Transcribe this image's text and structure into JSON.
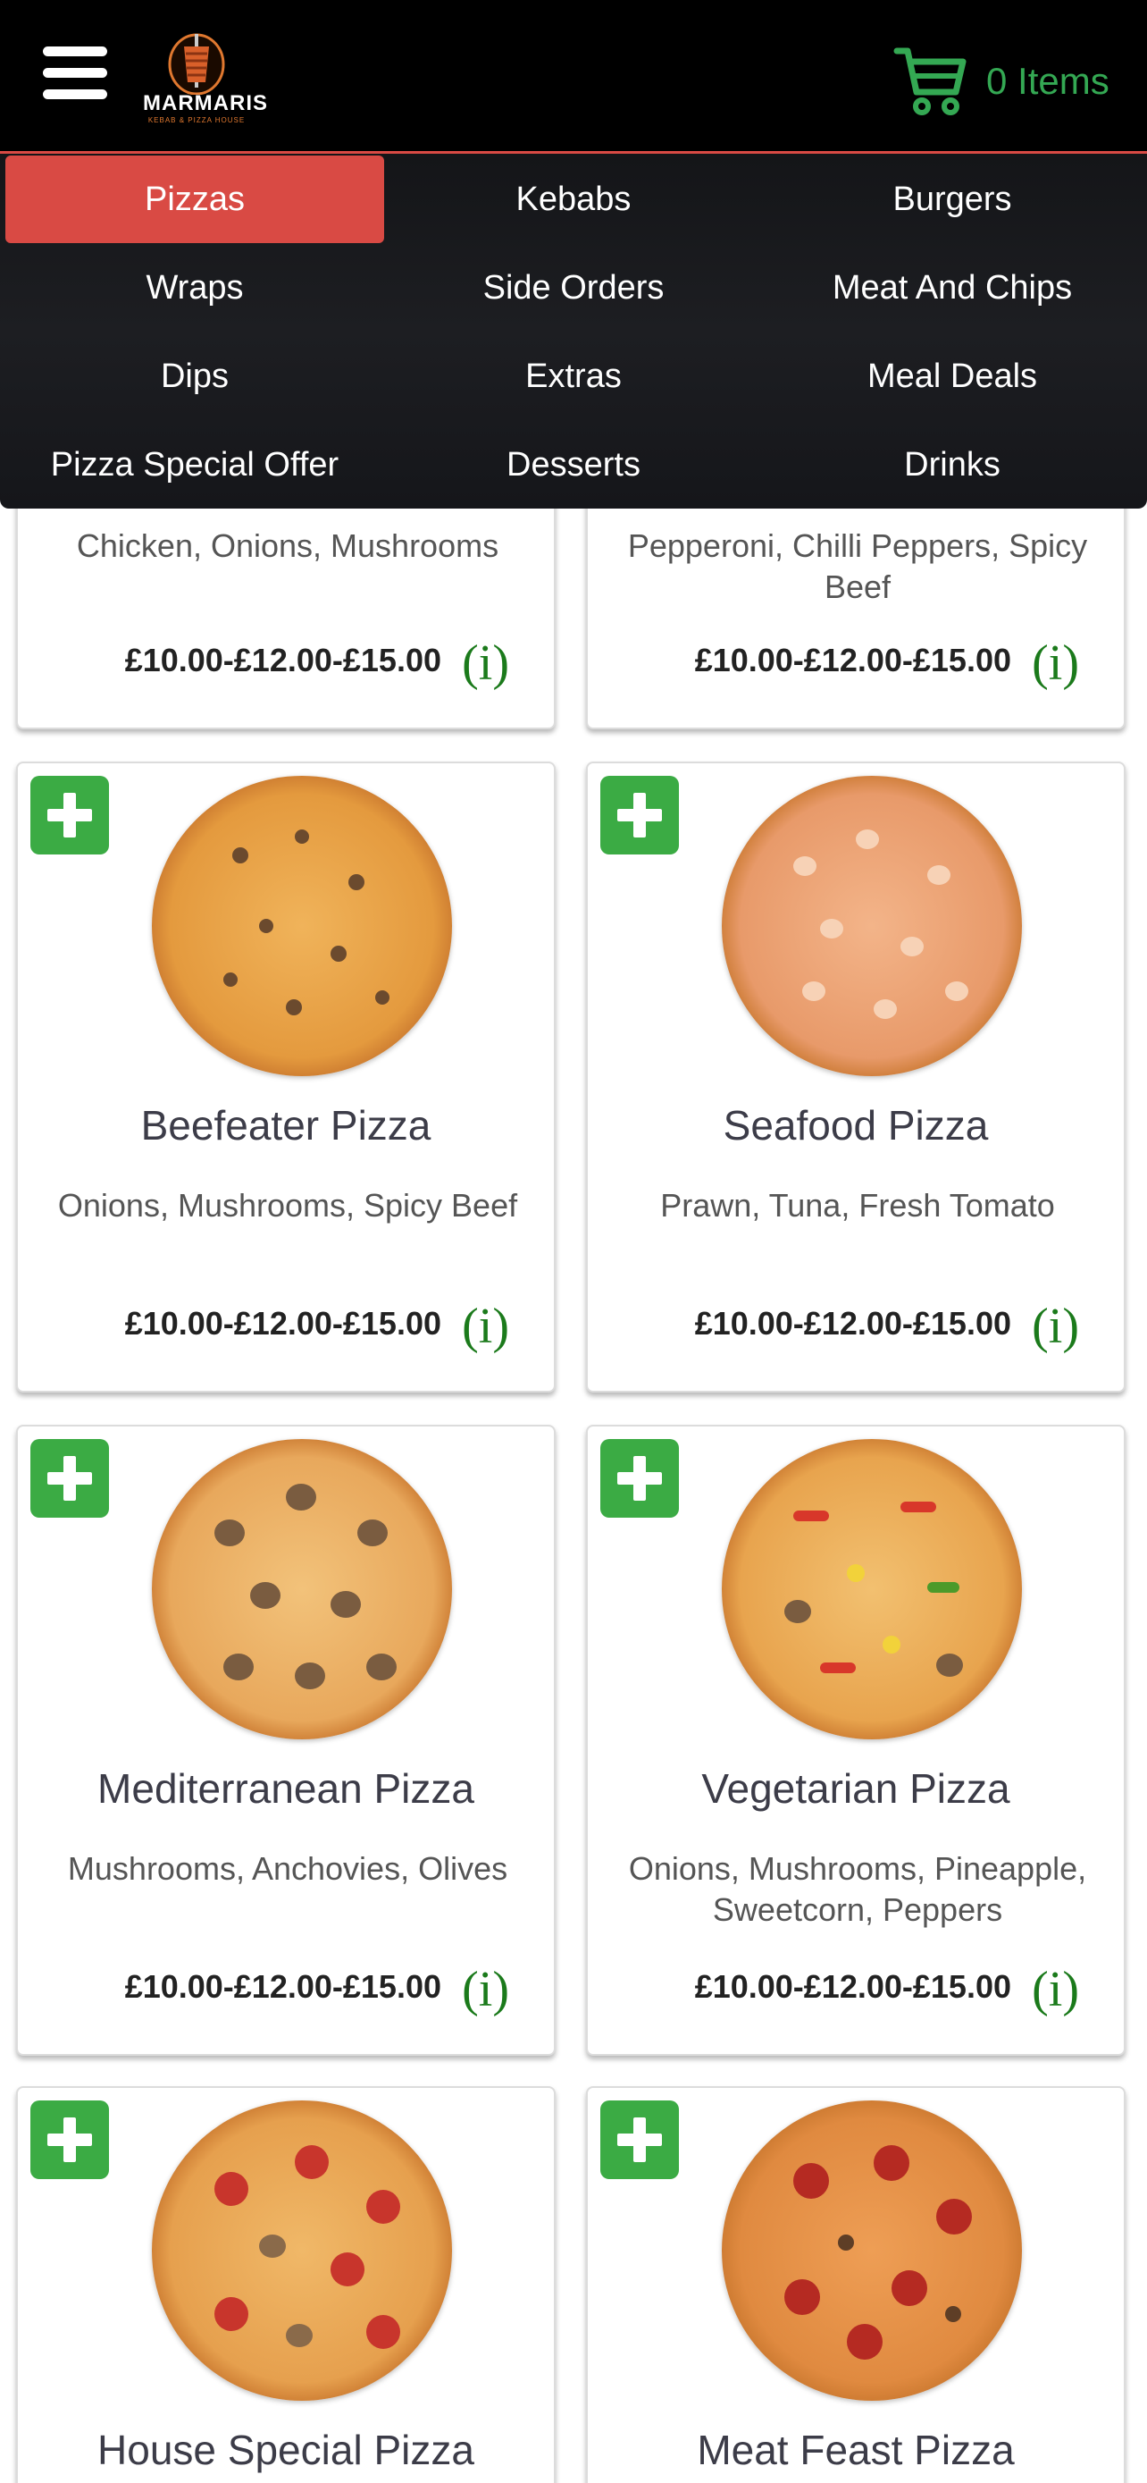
{
  "header": {
    "logo_name": "MARMARIS",
    "logo_sub": "KEBAB & PIZZA HOUSE",
    "cart_label": "0 Items",
    "menu_icon": "hamburger-menu-icon",
    "cart_icon": "shopping-cart-icon"
  },
  "categories": [
    {
      "label": "Pizzas",
      "active": true
    },
    {
      "label": "Kebabs"
    },
    {
      "label": "Burgers"
    },
    {
      "label": "Wraps"
    },
    {
      "label": "Side Orders"
    },
    {
      "label": "Meat And Chips"
    },
    {
      "label": "Dips"
    },
    {
      "label": "Extras"
    },
    {
      "label": "Meal Deals"
    },
    {
      "label": "Pizza Special Offer"
    },
    {
      "label": "Desserts"
    },
    {
      "label": "Drinks"
    }
  ],
  "products": [
    {
      "name": "",
      "desc": "Chicken, Onions, Mushrooms",
      "price": "£10.00-£12.00-£15.00",
      "info": "(i)"
    },
    {
      "name": "",
      "desc": "Pepperoni, Chilli Peppers, Spicy Beef",
      "price": "£10.00-£12.00-£15.00",
      "info": "(i)"
    },
    {
      "name": "Beefeater Pizza",
      "desc": "Onions, Mushrooms, Spicy Beef",
      "price": "£10.00-£12.00-£15.00",
      "info": "(i)"
    },
    {
      "name": "Seafood Pizza",
      "desc": "Prawn, Tuna, Fresh Tomato",
      "price": "£10.00-£12.00-£15.00",
      "info": "(i)"
    },
    {
      "name": "Mediterranean Pizza",
      "desc": "Mushrooms, Anchovies, Olives",
      "price": "£10.00-£12.00-£15.00",
      "info": "(i)"
    },
    {
      "name": "Vegetarian Pizza",
      "desc": "Onions, Mushrooms, Pineapple, Sweetcorn, Peppers",
      "price": "£10.00-£12.00-£15.00",
      "info": "(i)"
    },
    {
      "name": "House Special Pizza",
      "desc": "",
      "price": "",
      "info": ""
    },
    {
      "name": "Meat Feast Pizza",
      "desc": "",
      "price": "",
      "info": ""
    }
  ],
  "colors": {
    "accent_red": "#d94a44",
    "cart_green": "#34a853",
    "add_green": "#3bab44",
    "info_green": "#1b7a1b"
  }
}
